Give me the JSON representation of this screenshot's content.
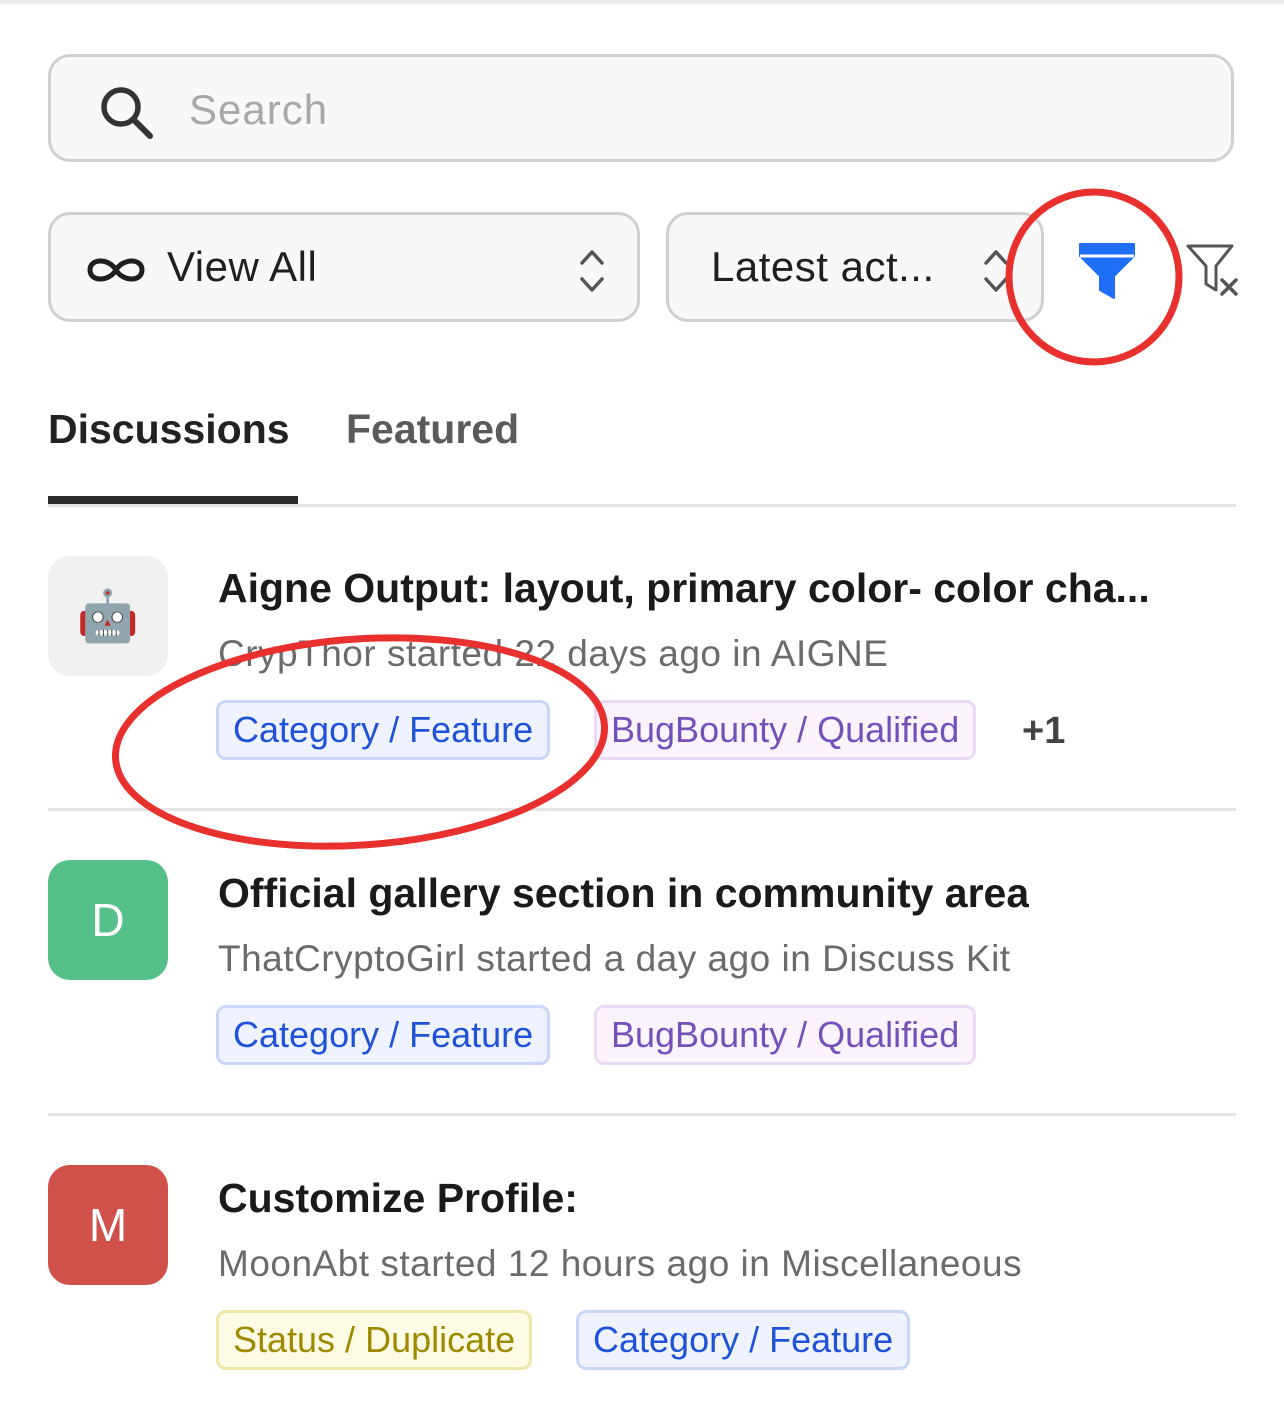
{
  "search": {
    "placeholder": "Search"
  },
  "filters": {
    "view": {
      "selected": "View All",
      "icon": "infinity-icon"
    },
    "sort": {
      "selected": "Latest act..."
    },
    "filter_icon_color": "#1e6ff5"
  },
  "tabs": [
    {
      "label": "Discussions",
      "active": true
    },
    {
      "label": "Featured",
      "active": false
    }
  ],
  "discussions": [
    {
      "avatar": "🤖",
      "avatar_bg": "#f1f1f1",
      "title": "Aigne Output: layout, primary color- color cha...",
      "meta": "CrypThor started 22 days ago in AIGNE",
      "tags": [
        "Category / Feature",
        "BugBounty / Qualified"
      ],
      "more": "+1"
    },
    {
      "avatar": "D",
      "avatar_bg": "#56c08a",
      "title": "Official gallery section in community area",
      "meta": "ThatCryptoGirl started a day ago in Discuss Kit",
      "tags": [
        "Category / Feature",
        "BugBounty / Qualified"
      ]
    },
    {
      "avatar": "M",
      "avatar_bg": "#cf5149",
      "title": "Customize Profile:",
      "meta": "MoonAbt started 12 hours ago in Miscellaneous",
      "tags": [
        "Status / Duplicate",
        "Category / Feature"
      ]
    }
  ],
  "annotation_color": "#e8302e"
}
